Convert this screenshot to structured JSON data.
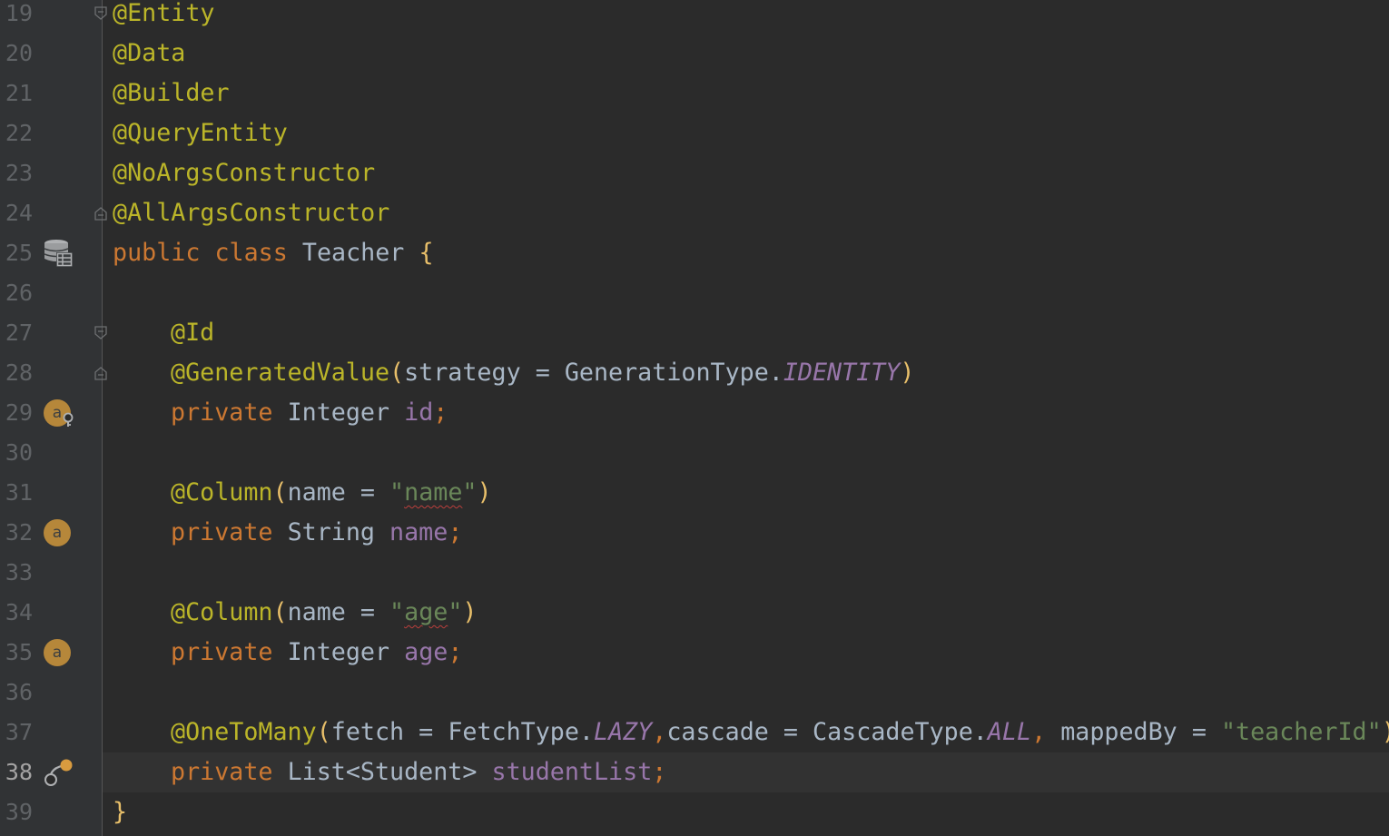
{
  "editor": {
    "language": "Java",
    "current_line": "38",
    "colors": {
      "background": "#2b2b2b",
      "gutter": "#313335",
      "annotation": "#bbb529",
      "keyword": "#cc7832",
      "field": "#9876aa",
      "string": "#6a8759",
      "default_text": "#a9b7c6",
      "line_number": "#606366"
    }
  },
  "lines": [
    {
      "num": "19",
      "code": {
        "t1": "@Entity"
      },
      "fold": "open"
    },
    {
      "num": "20",
      "code": {
        "t1": "@Data"
      }
    },
    {
      "num": "21",
      "code": {
        "t1": "@Builder"
      }
    },
    {
      "num": "22",
      "code": {
        "t1": "@QueryEntity"
      }
    },
    {
      "num": "23",
      "code": {
        "t1": "@NoArgsConstructor"
      }
    },
    {
      "num": "24",
      "code": {
        "t1": "@AllArgsConstructor"
      },
      "fold": "close"
    },
    {
      "num": "25",
      "gutter_icon": "database-table-icon",
      "code": {
        "kw1": "public",
        "kw2": "class",
        "name": "Teacher",
        "brace": "{"
      }
    },
    {
      "num": "26",
      "code": {}
    },
    {
      "num": "27",
      "code": {
        "t1": "@Id"
      },
      "fold": "open"
    },
    {
      "num": "28",
      "code": {
        "ann": "@GeneratedValue",
        "p1": "(",
        "arg": "strategy",
        "eq": " = ",
        "type": "GenerationType.",
        "const": "IDENTITY",
        "p2": ")"
      },
      "fold": "close"
    },
    {
      "num": "29",
      "gutter_icon": "attribute-key-icon",
      "code": {
        "kw": "private",
        "type": "Integer",
        "field": "id",
        "semi": ";"
      }
    },
    {
      "num": "30",
      "code": {}
    },
    {
      "num": "31",
      "code": {
        "ann": "@Column",
        "p1": "(",
        "arg": "name",
        "eq": " = ",
        "q1": "\"",
        "str": "name",
        "q2": "\"",
        "p2": ")"
      }
    },
    {
      "num": "32",
      "gutter_icon": "attribute-icon",
      "code": {
        "kw": "private",
        "type": "String",
        "field": "name",
        "semi": ";"
      }
    },
    {
      "num": "33",
      "code": {}
    },
    {
      "num": "34",
      "code": {
        "ann": "@Column",
        "p1": "(",
        "arg": "name",
        "eq": " = ",
        "q1": "\"",
        "str": "age",
        "q2": "\"",
        "p2": ")"
      }
    },
    {
      "num": "35",
      "gutter_icon": "attribute-icon",
      "code": {
        "kw": "private",
        "type": "Integer",
        "field": "age",
        "semi": ";"
      }
    },
    {
      "num": "36",
      "code": {}
    },
    {
      "num": "37",
      "code": {
        "ann": "@OneToMany",
        "p1": "(",
        "a1": "fetch",
        "e1": " = ",
        "t1": "FetchType.",
        "c1": "LAZY",
        "sep1": ",",
        "a2": "cascade",
        "e2": " = ",
        "t2": "CascadeType.",
        "c2": "ALL",
        "sep2": ", ",
        "a3": "mappedBy",
        "e3": " = ",
        "s3": "\"teacherId\"",
        "p2": ")"
      }
    },
    {
      "num": "38",
      "gutter_icon": "relationship-icon",
      "current": true,
      "code": {
        "kw": "private",
        "type": "List<Student>",
        "field": "studentList",
        "semi": ";"
      }
    },
    {
      "num": "39",
      "code": {
        "brace": "}"
      }
    }
  ]
}
